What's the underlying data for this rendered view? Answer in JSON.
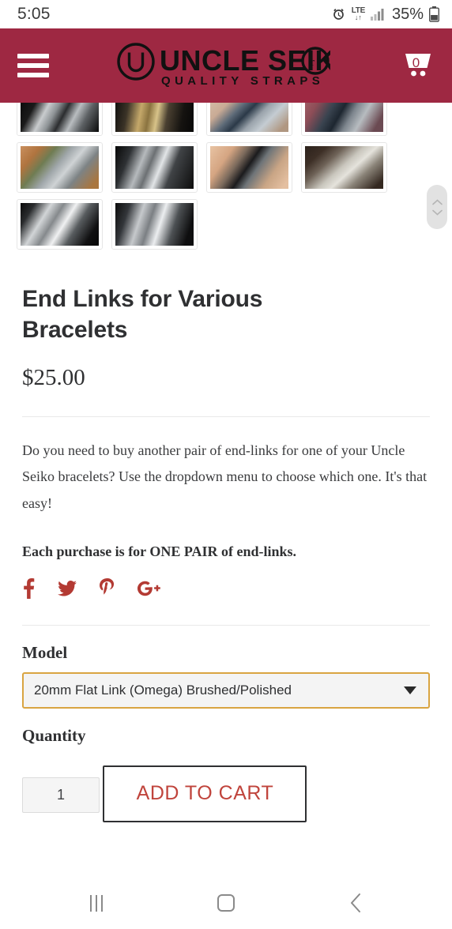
{
  "status_bar": {
    "time": "5:05",
    "network_type": "LTE",
    "data_arrows": "↓↑",
    "battery_percent": "35%",
    "icons": [
      "alarm-icon",
      "lte-icon",
      "signal-bars-icon",
      "battery-icon"
    ]
  },
  "header": {
    "menu_label": "Menu",
    "brand_name": "UNCLE SEIKO",
    "brand_tagline": "QUALITY STRAPS",
    "brand_mark": "U",
    "cart_count": "0",
    "background_color": "#9e2842"
  },
  "gallery": {
    "thumbnails": [
      {
        "alt": "jubilee-bracelet-on-black",
        "style": "ph-a"
      },
      {
        "alt": "gold-gmt-watch-on-black",
        "style": "ph-b"
      },
      {
        "alt": "blue-dive-watch-on-wrist",
        "style": "ph-c"
      },
      {
        "alt": "watch-on-wrist-red-sleeve",
        "style": "ph-d"
      },
      {
        "alt": "dive-watch-on-stone",
        "style": "ph-e"
      },
      {
        "alt": "dive-watch-closeup-black",
        "style": "ph-f"
      },
      {
        "alt": "black-dive-watch-on-wrist",
        "style": "ph-g"
      },
      {
        "alt": "bracelet-flat-on-table",
        "style": "ph-h"
      },
      {
        "alt": "jubilee-bracelet-detail",
        "style": "ph-i"
      },
      {
        "alt": "oyster-bracelet-detail",
        "style": "ph-j"
      }
    ]
  },
  "scroll_widget": {
    "up_icon": "chevron-up-icon",
    "down_icon": "chevron-down-icon"
  },
  "product": {
    "title": "End Links for Various Bracelets",
    "price": "$25.00",
    "description": "Do you need to buy another pair of end-links for one of your Uncle Seiko bracelets? Use the dropdown menu to choose which one. It's that easy!",
    "note": "Each purchase is for ONE PAIR of end-links."
  },
  "social": {
    "links": [
      {
        "name": "facebook",
        "glyph": "f"
      },
      {
        "name": "twitter",
        "glyph": "twitter-bird"
      },
      {
        "name": "pinterest",
        "glyph": "P"
      },
      {
        "name": "google-plus",
        "glyph": "G+"
      }
    ],
    "color": "#b33a33"
  },
  "options": {
    "model_label": "Model",
    "model_selected": "20mm Flat Link (Omega) Brushed/Polished",
    "model_focus_color": "#d9a441",
    "quantity_label": "Quantity",
    "quantity_value": "1",
    "add_to_cart_label": "ADD TO CART",
    "add_to_cart_color": "#c0443c"
  },
  "android_nav": {
    "recents_icon": "recents-icon",
    "home_icon": "home-icon",
    "back_icon": "back-chevron-icon"
  }
}
